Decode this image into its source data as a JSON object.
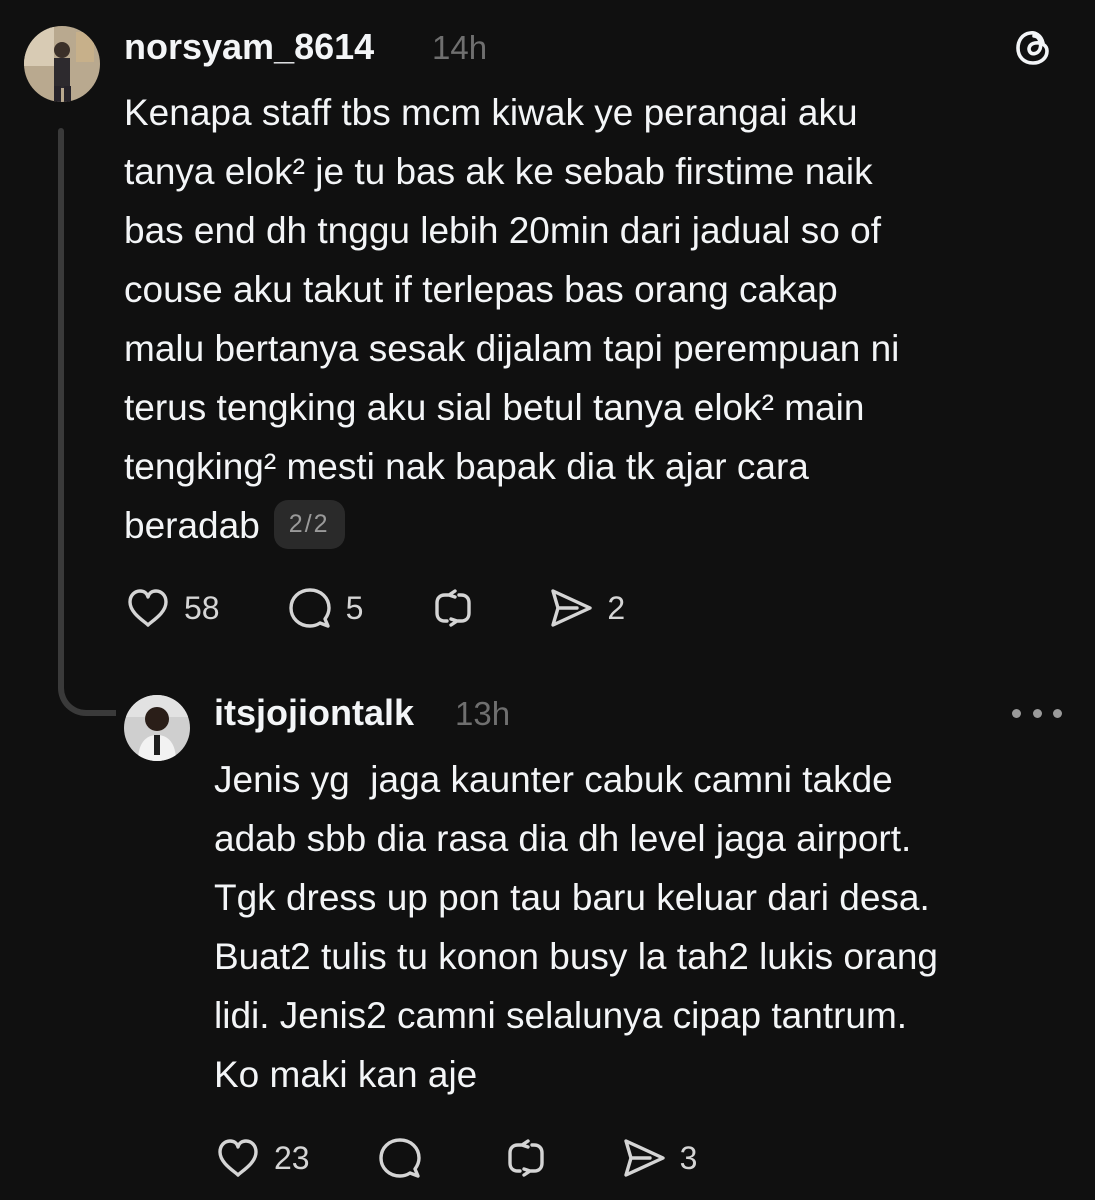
{
  "post": {
    "username": "norsyam_8614",
    "time": "14h",
    "body": "Kenapa staff tbs mcm kiwak ye perangai aku\ntanya elok² je tu bas ak ke sebab firstime naik\nbas end dh tnggu lebih 20min dari jadual so of\ncouse aku takut if terlepas bas orang cakap\nmalu bertanya sesak dijalam tapi perempuan ni\nterus tengking aku sial betul tanya elok² main\ntengking² mesti nak bapak dia tk ajar cara\nberadab",
    "pager": "2/2",
    "likes": "58",
    "replies": "5",
    "shares": "2"
  },
  "reply": {
    "username": "itsjojiontalk",
    "time": "13h",
    "body": "Jenis yg  jaga kaunter cabuk camni takde\nadab sbb dia rasa dia dh level jaga airport.\nTgk dress up pon tau baru keluar dari desa.\nBuat2 tulis tu konon busy la tah2 lukis orang\nlidi. Jenis2 camni selalunya cipap tantrum.\nKo maki kan aje",
    "likes": "23",
    "shares": "3"
  },
  "icons": {
    "logo": "threads-logo-icon",
    "like": "heart-icon",
    "reply": "comment-bubble-icon",
    "repost": "repost-icon",
    "share": "send-icon",
    "more": "more-icon"
  },
  "colors": {
    "background": "#101010",
    "text": "#f3f5f7",
    "muted": "#6f6f6f",
    "thread_line": "#3a3a3a"
  }
}
